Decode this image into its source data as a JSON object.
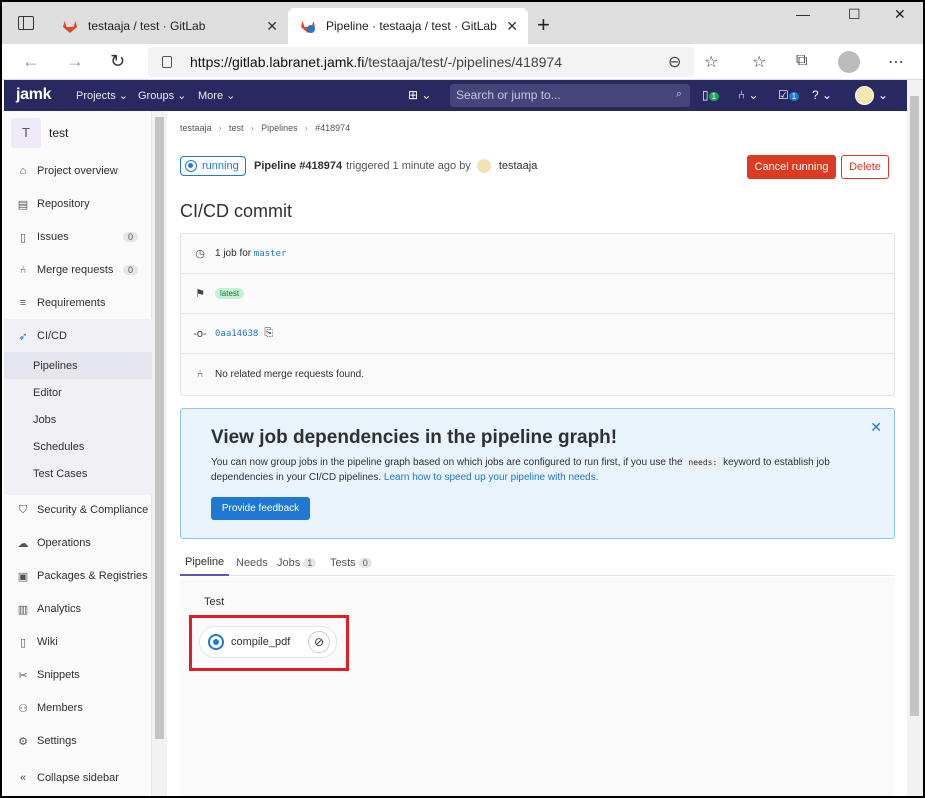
{
  "browser": {
    "tabs": [
      {
        "title": "testaaja / test · GitLab"
      },
      {
        "title": "Pipeline · testaaja / test · GitLab"
      }
    ],
    "url_host": "https://gitlab.labranet.jamk.fi",
    "url_path": "/testaaja/test/-/pipelines/418974"
  },
  "header": {
    "logo": "jamk",
    "menus": [
      "Projects",
      "Groups",
      "More"
    ],
    "search_placeholder": "Search or jump to...",
    "issues_badge": "1",
    "todo_badge": "1"
  },
  "sidebar": {
    "project_initial": "T",
    "project_name": "test",
    "items": [
      {
        "label": "Project overview",
        "icon": "home-icon"
      },
      {
        "label": "Repository",
        "icon": "book-icon"
      },
      {
        "label": "Issues",
        "icon": "issues-icon",
        "count": "0"
      },
      {
        "label": "Merge requests",
        "icon": "merge-request-icon",
        "count": "0"
      },
      {
        "label": "Requirements",
        "icon": "requirements-icon"
      },
      {
        "label": "CI/CD",
        "icon": "rocket-icon"
      }
    ],
    "cicd_sub": [
      "Pipelines",
      "Editor",
      "Jobs",
      "Schedules",
      "Test Cases"
    ],
    "items_after": [
      {
        "label": "Security & Compliance",
        "icon": "shield-icon"
      },
      {
        "label": "Operations",
        "icon": "cloud-icon"
      },
      {
        "label": "Packages & Registries",
        "icon": "package-icon"
      },
      {
        "label": "Analytics",
        "icon": "chart-icon"
      },
      {
        "label": "Wiki",
        "icon": "wiki-icon"
      },
      {
        "label": "Snippets",
        "icon": "scissors-icon"
      },
      {
        "label": "Members",
        "icon": "users-icon"
      },
      {
        "label": "Settings",
        "icon": "gear-icon"
      }
    ],
    "collapse": "Collapse sidebar"
  },
  "breadcrumb": [
    "testaaja",
    "test",
    "Pipelines",
    "#418974"
  ],
  "pipeline": {
    "status": "running",
    "id_label": "Pipeline #418974",
    "triggered": "triggered 1 minute ago by",
    "user": "testaaja",
    "cancel_label": "Cancel running",
    "delete_label": "Delete",
    "commit_title": "CI/CD commit",
    "jobs_text": "1 job for",
    "branch": "master",
    "tag": "latest",
    "sha": "0aa14638",
    "mr_text": "No related merge requests found."
  },
  "callout": {
    "title": "View job dependencies in the pipeline graph!",
    "text_before": "You can now group jobs in the pipeline graph based on which jobs are configured to run first, if you use the",
    "keyword": "needs:",
    "text_after": "keyword to establish job dependencies in your CI/CD pipelines.",
    "link": "Learn how to speed up your pipeline with needs.",
    "button": "Provide feedback"
  },
  "tabs": [
    {
      "label": "Pipeline",
      "count": ""
    },
    {
      "label": "Needs",
      "count": ""
    },
    {
      "label": "Jobs",
      "count": "1"
    },
    {
      "label": "Tests",
      "count": "0"
    }
  ],
  "graph": {
    "stage": "Test",
    "job": "compile_pdf"
  },
  "colors": {
    "header": "#292961",
    "danger": "#db3b21",
    "primary": "#1f78d1",
    "highlight": "#e01e26"
  }
}
